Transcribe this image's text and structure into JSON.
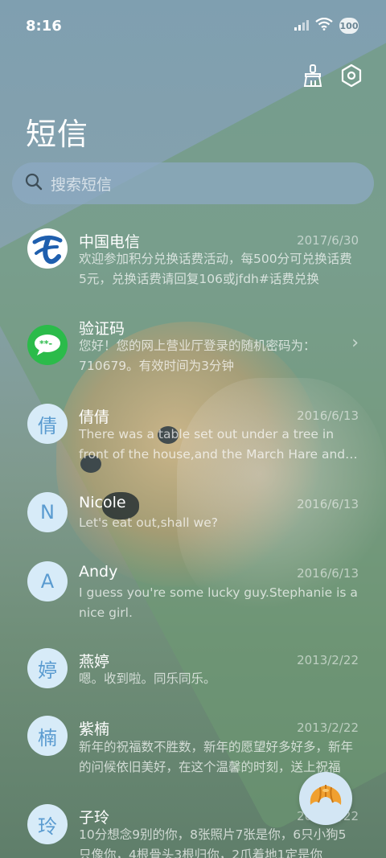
{
  "status_bar": {
    "time": "8:16",
    "battery": "100"
  },
  "header": {
    "title": "短信",
    "actions": [
      {
        "icon": "broom-icon",
        "label": "clean"
      },
      {
        "icon": "settings-hexagon-icon",
        "label": "settings"
      }
    ]
  },
  "search": {
    "placeholder": "搜索短信"
  },
  "conversations": [
    {
      "name": "中国电信",
      "date": "2017/6/30",
      "avatar": "",
      "avatar_icon": "china-telecom-logo-icon",
      "preview": "欢迎参加积分兑换话费活动，每500分可兑换话费5元，兑换话费请回复106或jfdh#话费兑换"
    },
    {
      "name": "验证码",
      "date": "",
      "avatar": "",
      "avatar_icon": "sms-code-bubble-icon",
      "preview": "您好！您的网上营业厅登录的随机密码为：710679。有效时间为3分钟"
    },
    {
      "name": "倩倩",
      "date": "2016/6/13",
      "avatar": "倩",
      "preview": "There was a table set out under a tree in front of the house,and the March Hare and the Hatter"
    },
    {
      "name": "Nicole",
      "date": "2016/6/13",
      "avatar": "N",
      "preview": "Let's eat out,shall we?"
    },
    {
      "name": "Andy",
      "date": "2016/6/13",
      "avatar": "A",
      "preview": "I guess you're some lucky guy.Stephanie is a nice girl."
    },
    {
      "name": "燕婷",
      "date": "2013/2/22",
      "avatar": "婷",
      "preview": "嗯。收到啦。同乐同乐。"
    },
    {
      "name": "紫楠",
      "date": "2013/2/22",
      "avatar": "楠",
      "preview": "新年的祝福数不胜数，新年的愿望好多好多，新年的问候依旧美好，在这个温馨的时刻，送上祝福"
    },
    {
      "name": "子玲",
      "date": "2013/2/22",
      "avatar": "玲",
      "preview": "10分想念9别的你，8张照片7张是你，6只小狗5只像你，4根骨头3根归你，2爪着地1定是你"
    }
  ],
  "fab": {
    "icon": "croissant-icon"
  },
  "colors": {
    "avatar_bg": "#d7ebf8",
    "avatar_text": "#5a9bd0",
    "telecom_blue": "#1f5fae",
    "sms_green": "#2bbb4a"
  }
}
